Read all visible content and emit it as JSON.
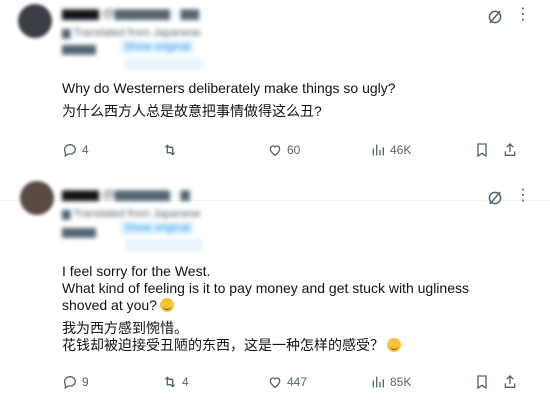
{
  "posts": [
    {
      "display_name": "▆▆▆▆",
      "handle_time": "@▆▆▆▆▆▆ · ▆▆",
      "translated_label": "▆ Translated from Japanese",
      "original_label": "Show original",
      "text_en": "Why do Westerners deliberately make things so ugly?",
      "text_zh": "为什么西方人总是故意把事情做得这么丑?",
      "replies": "4",
      "reposts": "",
      "likes": "60",
      "views": "46K",
      "avatar_color": "#3b3f45"
    },
    {
      "display_name": "▆▆▆▆",
      "handle_time": "@▆▆▆▆▆▆ · ▆",
      "translated_label": "▆ Translated from Japanese",
      "original_label": "Show original",
      "text_en_1": "I feel sorry for the West.",
      "text_en_2": "What kind of feeling is it to pay money and get stuck with ugliness shoved at you?",
      "text_zh_1": "我为西方感到惋惜。",
      "text_zh_2": "花钱却被迫接受丑陋的东西，这是一种怎样的感受？",
      "replies": "9",
      "reposts": "4",
      "likes": "447",
      "views": "85K",
      "avatar_color": "#5a4a44"
    }
  ]
}
